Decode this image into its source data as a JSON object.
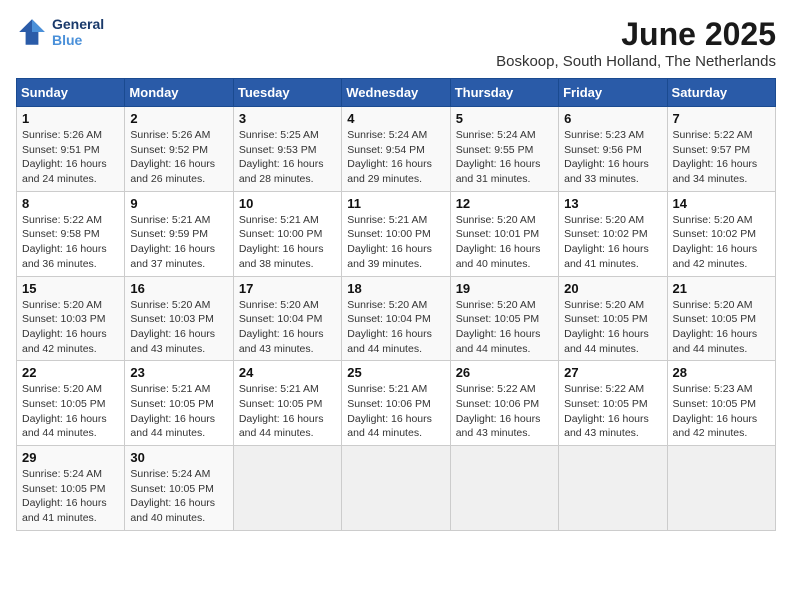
{
  "logo": {
    "line1": "General",
    "line2": "Blue"
  },
  "title": "June 2025",
  "subtitle": "Boskoop, South Holland, The Netherlands",
  "weekdays": [
    "Sunday",
    "Monday",
    "Tuesday",
    "Wednesday",
    "Thursday",
    "Friday",
    "Saturday"
  ],
  "weeks": [
    [
      {
        "day": "1",
        "info": "Sunrise: 5:26 AM\nSunset: 9:51 PM\nDaylight: 16 hours\nand 24 minutes."
      },
      {
        "day": "2",
        "info": "Sunrise: 5:26 AM\nSunset: 9:52 PM\nDaylight: 16 hours\nand 26 minutes."
      },
      {
        "day": "3",
        "info": "Sunrise: 5:25 AM\nSunset: 9:53 PM\nDaylight: 16 hours\nand 28 minutes."
      },
      {
        "day": "4",
        "info": "Sunrise: 5:24 AM\nSunset: 9:54 PM\nDaylight: 16 hours\nand 29 minutes."
      },
      {
        "day": "5",
        "info": "Sunrise: 5:24 AM\nSunset: 9:55 PM\nDaylight: 16 hours\nand 31 minutes."
      },
      {
        "day": "6",
        "info": "Sunrise: 5:23 AM\nSunset: 9:56 PM\nDaylight: 16 hours\nand 33 minutes."
      },
      {
        "day": "7",
        "info": "Sunrise: 5:22 AM\nSunset: 9:57 PM\nDaylight: 16 hours\nand 34 minutes."
      }
    ],
    [
      {
        "day": "8",
        "info": "Sunrise: 5:22 AM\nSunset: 9:58 PM\nDaylight: 16 hours\nand 36 minutes."
      },
      {
        "day": "9",
        "info": "Sunrise: 5:21 AM\nSunset: 9:59 PM\nDaylight: 16 hours\nand 37 minutes."
      },
      {
        "day": "10",
        "info": "Sunrise: 5:21 AM\nSunset: 10:00 PM\nDaylight: 16 hours\nand 38 minutes."
      },
      {
        "day": "11",
        "info": "Sunrise: 5:21 AM\nSunset: 10:00 PM\nDaylight: 16 hours\nand 39 minutes."
      },
      {
        "day": "12",
        "info": "Sunrise: 5:20 AM\nSunset: 10:01 PM\nDaylight: 16 hours\nand 40 minutes."
      },
      {
        "day": "13",
        "info": "Sunrise: 5:20 AM\nSunset: 10:02 PM\nDaylight: 16 hours\nand 41 minutes."
      },
      {
        "day": "14",
        "info": "Sunrise: 5:20 AM\nSunset: 10:02 PM\nDaylight: 16 hours\nand 42 minutes."
      }
    ],
    [
      {
        "day": "15",
        "info": "Sunrise: 5:20 AM\nSunset: 10:03 PM\nDaylight: 16 hours\nand 42 minutes."
      },
      {
        "day": "16",
        "info": "Sunrise: 5:20 AM\nSunset: 10:03 PM\nDaylight: 16 hours\nand 43 minutes."
      },
      {
        "day": "17",
        "info": "Sunrise: 5:20 AM\nSunset: 10:04 PM\nDaylight: 16 hours\nand 43 minutes."
      },
      {
        "day": "18",
        "info": "Sunrise: 5:20 AM\nSunset: 10:04 PM\nDaylight: 16 hours\nand 44 minutes."
      },
      {
        "day": "19",
        "info": "Sunrise: 5:20 AM\nSunset: 10:05 PM\nDaylight: 16 hours\nand 44 minutes."
      },
      {
        "day": "20",
        "info": "Sunrise: 5:20 AM\nSunset: 10:05 PM\nDaylight: 16 hours\nand 44 minutes."
      },
      {
        "day": "21",
        "info": "Sunrise: 5:20 AM\nSunset: 10:05 PM\nDaylight: 16 hours\nand 44 minutes."
      }
    ],
    [
      {
        "day": "22",
        "info": "Sunrise: 5:20 AM\nSunset: 10:05 PM\nDaylight: 16 hours\nand 44 minutes."
      },
      {
        "day": "23",
        "info": "Sunrise: 5:21 AM\nSunset: 10:05 PM\nDaylight: 16 hours\nand 44 minutes."
      },
      {
        "day": "24",
        "info": "Sunrise: 5:21 AM\nSunset: 10:05 PM\nDaylight: 16 hours\nand 44 minutes."
      },
      {
        "day": "25",
        "info": "Sunrise: 5:21 AM\nSunset: 10:06 PM\nDaylight: 16 hours\nand 44 minutes."
      },
      {
        "day": "26",
        "info": "Sunrise: 5:22 AM\nSunset: 10:06 PM\nDaylight: 16 hours\nand 43 minutes."
      },
      {
        "day": "27",
        "info": "Sunrise: 5:22 AM\nSunset: 10:05 PM\nDaylight: 16 hours\nand 43 minutes."
      },
      {
        "day": "28",
        "info": "Sunrise: 5:23 AM\nSunset: 10:05 PM\nDaylight: 16 hours\nand 42 minutes."
      }
    ],
    [
      {
        "day": "29",
        "info": "Sunrise: 5:24 AM\nSunset: 10:05 PM\nDaylight: 16 hours\nand 41 minutes."
      },
      {
        "day": "30",
        "info": "Sunrise: 5:24 AM\nSunset: 10:05 PM\nDaylight: 16 hours\nand 40 minutes."
      },
      {
        "day": "",
        "info": ""
      },
      {
        "day": "",
        "info": ""
      },
      {
        "day": "",
        "info": ""
      },
      {
        "day": "",
        "info": ""
      },
      {
        "day": "",
        "info": ""
      }
    ]
  ]
}
